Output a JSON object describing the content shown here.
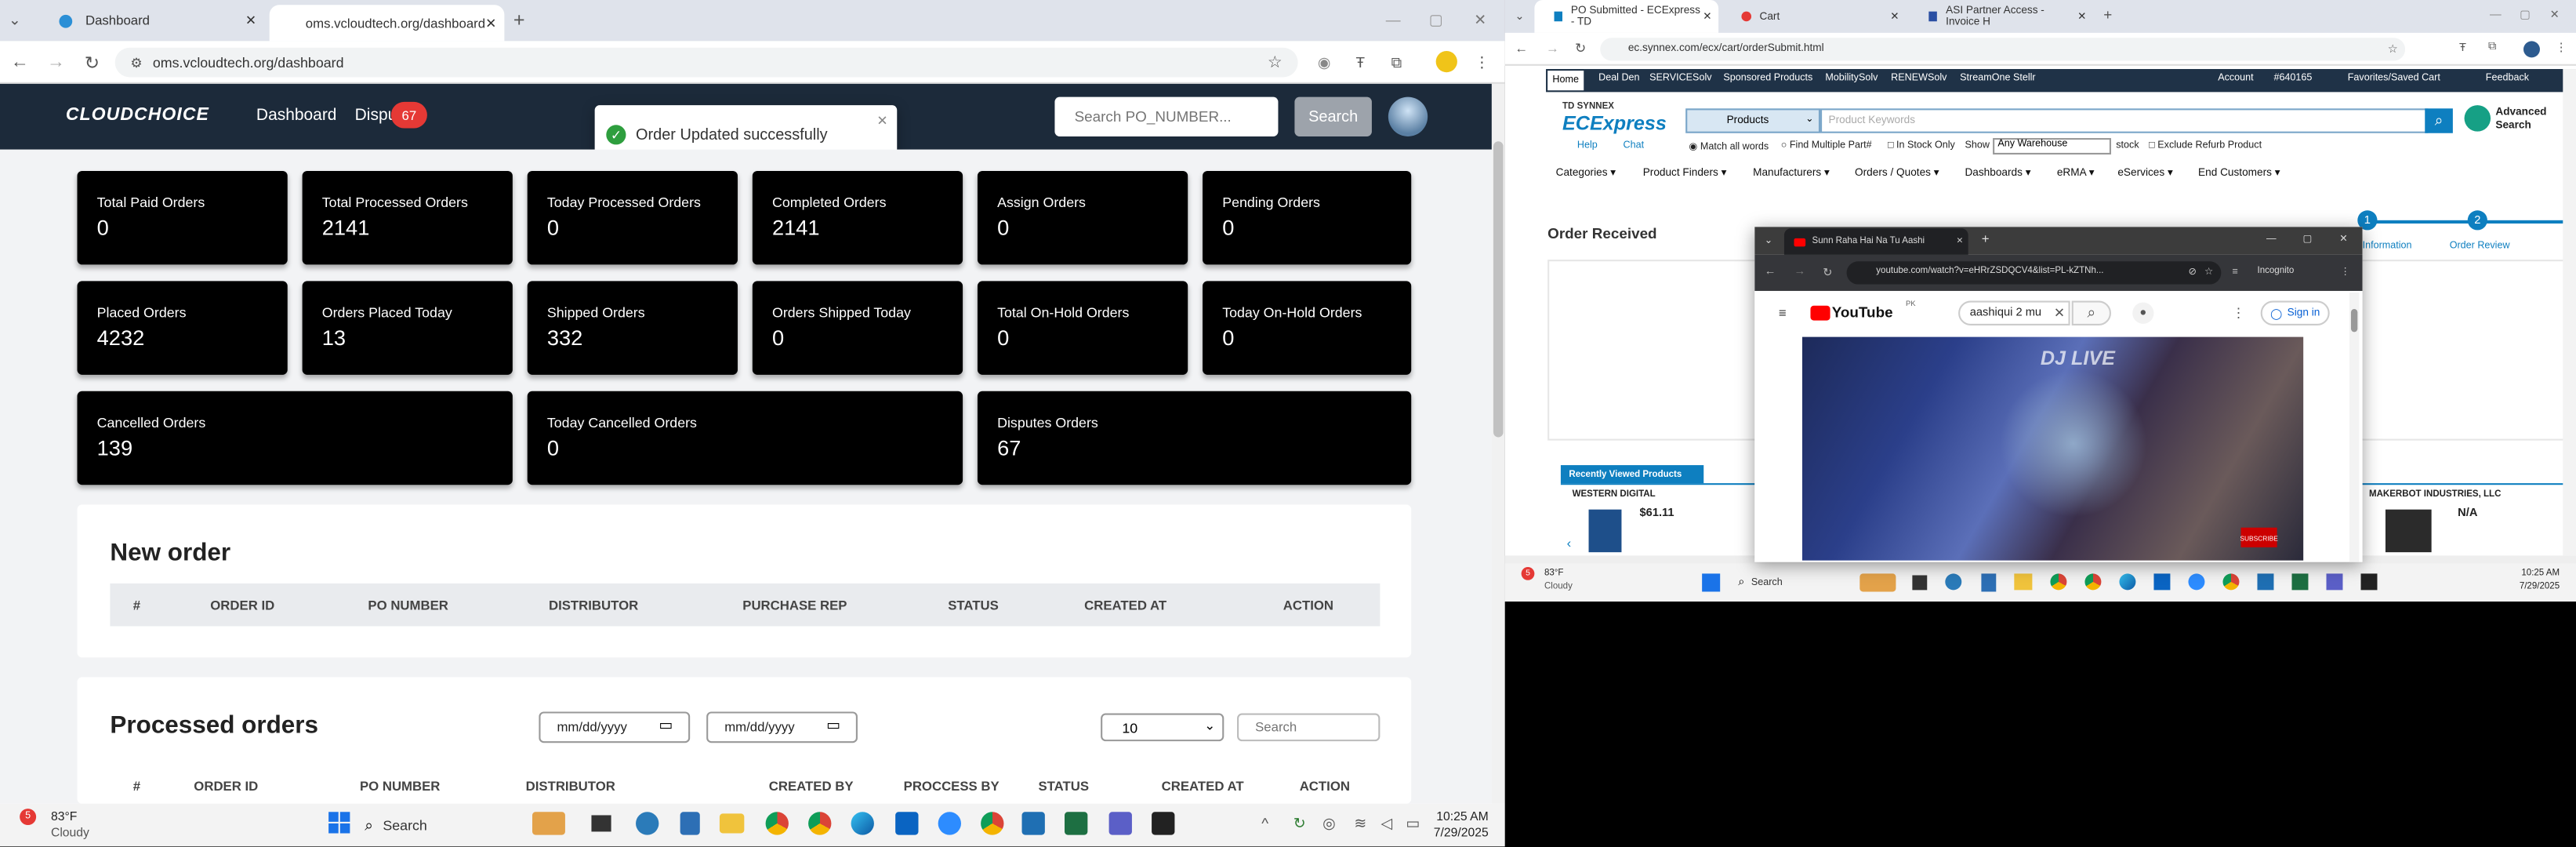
{
  "left_browser": {
    "tabs": [
      {
        "title": "Dashboard",
        "active": false
      },
      {
        "title": "oms.vcloudtech.org/dashboard",
        "active": true
      }
    ],
    "url": "oms.vcloudtech.org/dashboard"
  },
  "app": {
    "logo": "CLOUDCHOICE",
    "nav": {
      "dashboard": "Dashboard",
      "disputes": "Dispu",
      "disputes_badge": "67"
    },
    "search": {
      "placeholder": "Search PO_NUMBER...",
      "button": "Search"
    },
    "toast": "Order Updated successfully"
  },
  "stats": [
    {
      "label": "Total Paid Orders",
      "value": "0"
    },
    {
      "label": "Total Processed Orders",
      "value": "2141"
    },
    {
      "label": "Today Processed Orders",
      "value": "0"
    },
    {
      "label": "Completed Orders",
      "value": "2141"
    },
    {
      "label": "Assign Orders",
      "value": "0"
    },
    {
      "label": "Pending Orders",
      "value": "0"
    },
    {
      "label": "Placed Orders",
      "value": "4232"
    },
    {
      "label": "Orders Placed Today",
      "value": "13"
    },
    {
      "label": "Shipped Orders",
      "value": "332"
    },
    {
      "label": "Orders Shipped Today",
      "value": "0"
    },
    {
      "label": "Total On-Hold Orders",
      "value": "0"
    },
    {
      "label": "Today On-Hold Orders",
      "value": "0"
    },
    {
      "label": "Cancelled Orders",
      "value": "139"
    },
    {
      "label": "Today Cancelled Orders",
      "value": "0"
    },
    {
      "label": "Disputes Orders",
      "value": "67"
    }
  ],
  "new_order": {
    "title": "New order",
    "columns": [
      "#",
      "ORDER ID",
      "PO NUMBER",
      "DISTRIBUTOR",
      "PURCHASE REP",
      "STATUS",
      "CREATED AT",
      "ACTION"
    ]
  },
  "processed_orders": {
    "title": "Processed orders",
    "date_from_placeholder": "mm/dd/yyyy",
    "date_to_placeholder": "mm/dd/yyyy",
    "page_size": "10",
    "search_placeholder": "Search",
    "columns": [
      "#",
      "ORDER ID",
      "PO NUMBER",
      "DISTRIBUTOR",
      "CREATED BY",
      "PROCCESS BY",
      "STATUS",
      "CREATED AT",
      "ACTION"
    ]
  },
  "left_taskbar": {
    "weather_temp": "83°F",
    "weather_desc": "Cloudy",
    "weather_badge": "5",
    "search": "Search",
    "time": "10:25 AM",
    "date": "7/29/2025"
  },
  "right_browser": {
    "tabs": [
      {
        "title": "PO Submitted - ECExpress - TD"
      },
      {
        "title": "Cart"
      },
      {
        "title": "ASI Partner Access - Invoice H"
      }
    ],
    "url": "ec.synnex.com/ecx/cart/orderSubmit.html",
    "topnav": [
      "Home",
      "Deal Den",
      "SERVICESolv",
      "Sponsored Products",
      "MobilitySolv",
      "RENEWSolv",
      "StreamOne Stellr"
    ],
    "account": "Account",
    "account_id": "#640165",
    "favorites": "Favorites/Saved Cart",
    "feedback": "Feedback",
    "brand_top": "TD SYNNEX",
    "brand": "ECExpress",
    "search_category": "Products",
    "search_placeholder": "Product Keywords",
    "advanced_search": "Advanced Search",
    "help": "Help",
    "chat": "Chat",
    "match_all": "Match all words",
    "find_multiple": "Find Multiple Part#",
    "in_stock": "In Stock Only",
    "show": "Show",
    "warehouse": "Any Warehouse",
    "stock": "stock",
    "exclude_refurb": "Exclude Refurb Product",
    "menu": [
      "Categories",
      "Product Finders",
      "Manufacturers",
      "Orders / Quotes",
      "Dashboards",
      "eRMA",
      "eServices",
      "End Customers"
    ],
    "order_received": "Order Received",
    "steps": [
      {
        "num": "1",
        "label": "Information"
      },
      {
        "num": "2",
        "label": "Order Review"
      }
    ],
    "recently_viewed": "Recently Viewed Products",
    "products": [
      {
        "vendor": "WESTERN DIGITAL",
        "price": "$61.11"
      },
      {
        "vendor": "MAKERBOT INDUSTRIES, LLC",
        "price": "N/A"
      }
    ]
  },
  "popup": {
    "tab_title": "Sunn Raha Hai Na Tu Aashi",
    "url": "youtube.com/watch?v=eHRrZSDQCV4&list=PL-kZTNh...",
    "incognito": "Incognito",
    "youtube": "YouTube",
    "country": "PK",
    "search_value": "aashiqui 2 mu",
    "sign_in": "Sign in",
    "video_overlay": "DJ LIVE",
    "subscribe": "SUBSCRIBE"
  },
  "right_taskbar": {
    "weather_temp": "83°F",
    "weather_desc": "Cloudy",
    "weather_badge": "5",
    "search": "Search",
    "time": "10:25 AM",
    "date": "7/29/2025"
  }
}
